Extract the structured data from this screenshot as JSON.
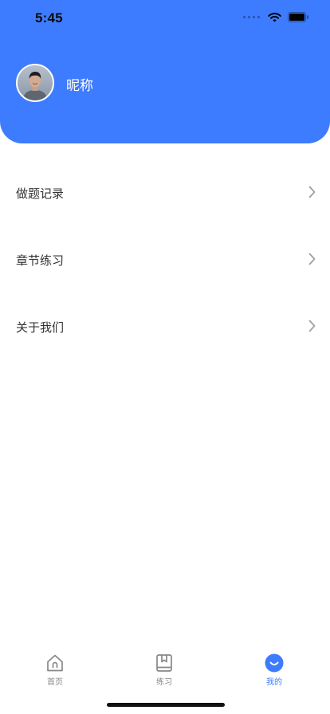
{
  "status_bar": {
    "time": "5:45"
  },
  "profile": {
    "nickname": "昵称"
  },
  "menu": [
    {
      "label": "做题记录"
    },
    {
      "label": "章节练习"
    },
    {
      "label": "关于我们"
    }
  ],
  "tabs": [
    {
      "label": "首页",
      "icon": "home-icon",
      "active": false
    },
    {
      "label": "练习",
      "icon": "book-icon",
      "active": false
    },
    {
      "label": "我的",
      "icon": "smile-icon",
      "active": true
    }
  ],
  "colors": {
    "accent": "#3d7cfe",
    "tab_inactive": "#888888"
  }
}
